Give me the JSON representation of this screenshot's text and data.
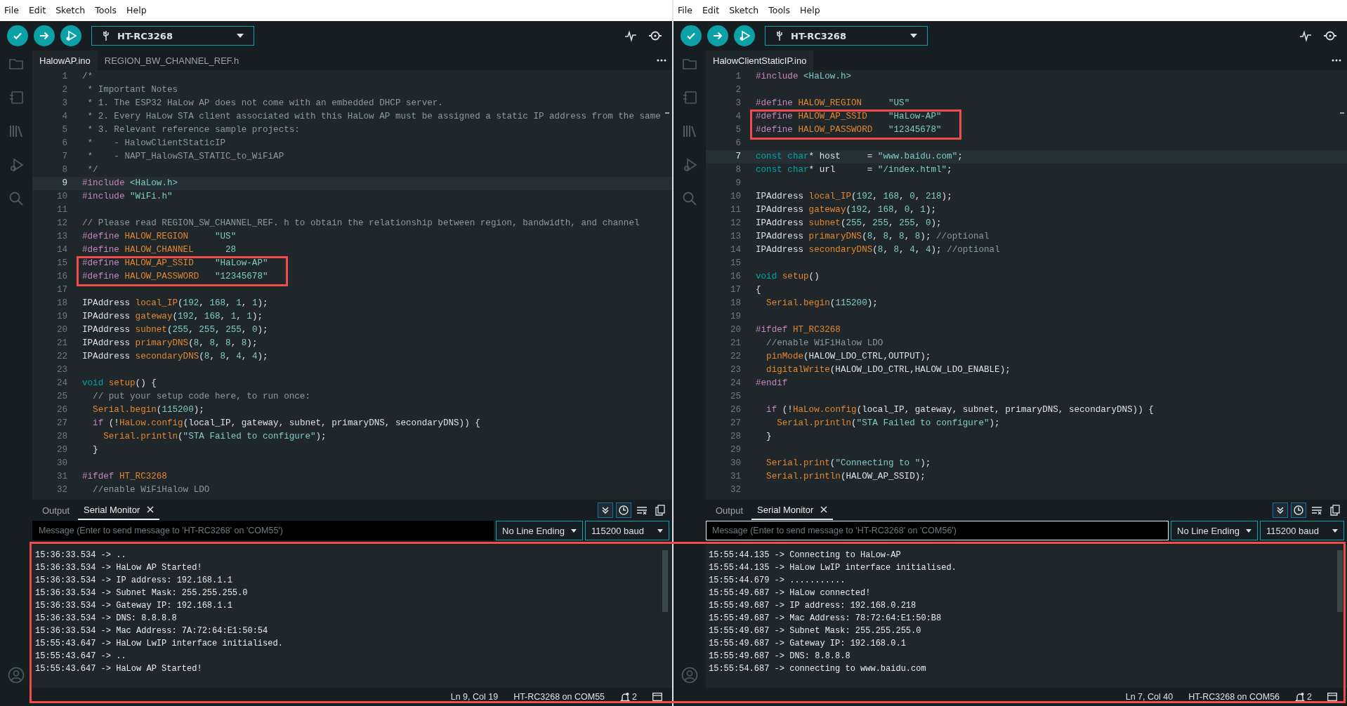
{
  "windows": [
    {
      "menu": [
        "File",
        "Edit",
        "Sketch",
        "Tools",
        "Help"
      ],
      "board": "HT-RC3268",
      "tabs": [
        {
          "label": "HalowAP.ino",
          "selected": true
        },
        {
          "label": "REGION_BW_CHANNEL_REF.h",
          "selected": false
        }
      ],
      "lines": [
        {
          "n": "1",
          "current": false,
          "boxed": false,
          "tokens": [
            {
              "kind": "comment",
              "text": "/*"
            }
          ]
        },
        {
          "n": "2",
          "current": false,
          "boxed": false,
          "tokens": [
            {
              "kind": "comment",
              "text": " * Important Notes"
            }
          ]
        },
        {
          "n": "3",
          "current": false,
          "boxed": false,
          "tokens": [
            {
              "kind": "comment",
              "text": " * 1. The ESP32 HaLow AP does not come with an embedded DHCP server."
            }
          ]
        },
        {
          "n": "4",
          "current": false,
          "boxed": false,
          "tokens": [
            {
              "kind": "comment",
              "text": " * 2. Every HaLow STA client associated with this HaLow AP must be assigned a static IP address from the same"
            }
          ]
        },
        {
          "n": "5",
          "current": false,
          "boxed": false,
          "tokens": [
            {
              "kind": "comment",
              "text": " * 3. Relevant reference sample projects:"
            }
          ]
        },
        {
          "n": "6",
          "current": false,
          "boxed": false,
          "tokens": [
            {
              "kind": "comment",
              "text": " *    - HalowClientStaticIP"
            }
          ]
        },
        {
          "n": "7",
          "current": false,
          "boxed": false,
          "tokens": [
            {
              "kind": "comment",
              "text": " *    - NAPT_HalowSTA_STATIC_to_WiFiAP"
            }
          ]
        },
        {
          "n": "8",
          "current": false,
          "boxed": false,
          "tokens": [
            {
              "kind": "comment",
              "text": " */"
            }
          ]
        },
        {
          "n": "9",
          "current": true,
          "boxed": false,
          "tokens": [
            {
              "kind": "preproc",
              "text": "#include "
            },
            {
              "kind": "string",
              "text": "<HaLow.h>"
            }
          ]
        },
        {
          "n": "10",
          "current": false,
          "boxed": false,
          "tokens": [
            {
              "kind": "preproc",
              "text": "#include "
            },
            {
              "kind": "string",
              "text": "\"WiFi.h\""
            }
          ]
        },
        {
          "n": "11",
          "current": false,
          "boxed": false
        },
        {
          "n": "12",
          "current": false,
          "boxed": false,
          "tokens": [
            {
              "kind": "comment",
              "text": "// Please read REGION_SW_CHANNEL_REF. h to obtain the relationship between region, bandwidth, and channel"
            }
          ]
        },
        {
          "n": "13",
          "current": false,
          "boxed": false,
          "tokens": [
            {
              "kind": "preproc",
              "text": "#define "
            },
            {
              "kind": "macro",
              "text": "HALOW_REGION     "
            },
            {
              "kind": "string",
              "text": "\"US\""
            }
          ]
        },
        {
          "n": "14",
          "current": false,
          "boxed": false,
          "tokens": [
            {
              "kind": "preproc",
              "text": "#define "
            },
            {
              "kind": "macro",
              "text": "HALOW_CHANNEL      "
            },
            {
              "kind": "number",
              "text": "28"
            }
          ]
        },
        {
          "n": "15",
          "current": false,
          "boxed": true,
          "tokens": [
            {
              "kind": "preproc",
              "text": "#define "
            },
            {
              "kind": "macro",
              "text": "HALOW_AP_SSID    "
            },
            {
              "kind": "string",
              "text": "\"HaLow-AP\""
            }
          ]
        },
        {
          "n": "16",
          "current": false,
          "boxed": true,
          "tokens": [
            {
              "kind": "preproc",
              "text": "#define "
            },
            {
              "kind": "macro",
              "text": "HALOW_PASSWORD   "
            },
            {
              "kind": "string",
              "text": "\"12345678\""
            }
          ]
        },
        {
          "n": "17",
          "current": false,
          "boxed": false
        },
        {
          "n": "18",
          "current": false,
          "boxed": false,
          "tokens": [
            {
              "kind": "plain",
              "text": "IPAddress "
            },
            {
              "kind": "func",
              "text": "local_IP"
            },
            {
              "kind": "plain",
              "text": "("
            },
            {
              "kind": "number",
              "text": "192"
            },
            {
              "kind": "plain",
              "text": ", "
            },
            {
              "kind": "number",
              "text": "168"
            },
            {
              "kind": "plain",
              "text": ", "
            },
            {
              "kind": "number",
              "text": "1"
            },
            {
              "kind": "plain",
              "text": ", "
            },
            {
              "kind": "number",
              "text": "1"
            },
            {
              "kind": "plain",
              "text": ");"
            }
          ]
        },
        {
          "n": "19",
          "current": false,
          "boxed": false,
          "tokens": [
            {
              "kind": "plain",
              "text": "IPAddress "
            },
            {
              "kind": "func",
              "text": "gateway"
            },
            {
              "kind": "plain",
              "text": "("
            },
            {
              "kind": "number",
              "text": "192"
            },
            {
              "kind": "plain",
              "text": ", "
            },
            {
              "kind": "number",
              "text": "168"
            },
            {
              "kind": "plain",
              "text": ", "
            },
            {
              "kind": "number",
              "text": "1"
            },
            {
              "kind": "plain",
              "text": ", "
            },
            {
              "kind": "number",
              "text": "1"
            },
            {
              "kind": "plain",
              "text": ");"
            }
          ]
        },
        {
          "n": "20",
          "current": false,
          "boxed": false,
          "tokens": [
            {
              "kind": "plain",
              "text": "IPAddress "
            },
            {
              "kind": "func",
              "text": "subnet"
            },
            {
              "kind": "plain",
              "text": "("
            },
            {
              "kind": "number",
              "text": "255"
            },
            {
              "kind": "plain",
              "text": ", "
            },
            {
              "kind": "number",
              "text": "255"
            },
            {
              "kind": "plain",
              "text": ", "
            },
            {
              "kind": "number",
              "text": "255"
            },
            {
              "kind": "plain",
              "text": ", "
            },
            {
              "kind": "number",
              "text": "0"
            },
            {
              "kind": "plain",
              "text": ");"
            }
          ]
        },
        {
          "n": "21",
          "current": false,
          "boxed": false,
          "tokens": [
            {
              "kind": "plain",
              "text": "IPAddress "
            },
            {
              "kind": "func",
              "text": "primaryDNS"
            },
            {
              "kind": "plain",
              "text": "("
            },
            {
              "kind": "number",
              "text": "8"
            },
            {
              "kind": "plain",
              "text": ", "
            },
            {
              "kind": "number",
              "text": "8"
            },
            {
              "kind": "plain",
              "text": ", "
            },
            {
              "kind": "number",
              "text": "8"
            },
            {
              "kind": "plain",
              "text": ", "
            },
            {
              "kind": "number",
              "text": "8"
            },
            {
              "kind": "plain",
              "text": ");"
            }
          ]
        },
        {
          "n": "22",
          "current": false,
          "boxed": false,
          "tokens": [
            {
              "kind": "plain",
              "text": "IPAddress "
            },
            {
              "kind": "func",
              "text": "secondaryDNS"
            },
            {
              "kind": "plain",
              "text": "("
            },
            {
              "kind": "number",
              "text": "8"
            },
            {
              "kind": "plain",
              "text": ", "
            },
            {
              "kind": "number",
              "text": "8"
            },
            {
              "kind": "plain",
              "text": ", "
            },
            {
              "kind": "number",
              "text": "4"
            },
            {
              "kind": "plain",
              "text": ", "
            },
            {
              "kind": "number",
              "text": "4"
            },
            {
              "kind": "plain",
              "text": ");"
            }
          ]
        },
        {
          "n": "23",
          "current": false,
          "boxed": false
        },
        {
          "n": "24",
          "current": false,
          "boxed": false,
          "tokens": [
            {
              "kind": "type",
              "text": "void "
            },
            {
              "kind": "func",
              "text": "setup"
            },
            {
              "kind": "plain",
              "text": "() {"
            }
          ]
        },
        {
          "n": "25",
          "current": false,
          "boxed": false,
          "tokens": [
            {
              "kind": "comment",
              "text": "  // put your setup code here, to run once:"
            }
          ]
        },
        {
          "n": "26",
          "current": false,
          "boxed": false,
          "tokens": [
            {
              "kind": "func",
              "text": "  Serial.begin"
            },
            {
              "kind": "plain",
              "text": "("
            },
            {
              "kind": "number",
              "text": "115200"
            },
            {
              "kind": "plain",
              "text": ");"
            }
          ]
        },
        {
          "n": "27",
          "current": false,
          "boxed": false,
          "tokens": [
            {
              "kind": "preproc",
              "text": "  if"
            },
            {
              "kind": "plain",
              "text": " (!"
            },
            {
              "kind": "func",
              "text": "HaLow.config"
            },
            {
              "kind": "plain",
              "text": "(local_IP, gateway, subnet, primaryDNS, secondaryDNS)) {"
            }
          ]
        },
        {
          "n": "28",
          "current": false,
          "boxed": false,
          "tokens": [
            {
              "kind": "func",
              "text": "    Serial.println"
            },
            {
              "kind": "plain",
              "text": "("
            },
            {
              "kind": "string",
              "text": "\"STA Failed to configure\""
            },
            {
              "kind": "plain",
              "text": ");"
            }
          ]
        },
        {
          "n": "29",
          "current": false,
          "boxed": false,
          "tokens": [
            {
              "kind": "plain",
              "text": "  }"
            }
          ]
        },
        {
          "n": "30",
          "current": false,
          "boxed": false
        },
        {
          "n": "31",
          "current": false,
          "boxed": false,
          "tokens": [
            {
              "kind": "preproc",
              "text": "#ifdef "
            },
            {
              "kind": "macro",
              "text": "HT_RC3268"
            }
          ]
        },
        {
          "n": "32",
          "current": false,
          "boxed": false,
          "tokens": [
            {
              "kind": "comment",
              "text": "  //enable WiFiHalow LDO"
            }
          ]
        }
      ],
      "panel_tabs": [
        {
          "label": "Output",
          "selected": false
        },
        {
          "label": "Serial Monitor",
          "selected": true
        }
      ],
      "autoscroll_on": true,
      "timestamp_on": true,
      "message": {
        "placeholder": "Message (Enter to send message to 'HT-RC3268' on 'COM55')",
        "focused": false
      },
      "line_ending": "No Line Ending",
      "baud": "115200 baud",
      "output": [
        "15:36:33.534 -> ..",
        "15:36:33.534 -> HaLow AP Started!",
        "15:36:33.534 -> IP address: 192.168.1.1",
        "15:36:33.534 -> Subnet Mask: 255.255.255.0",
        "15:36:33.534 -> Gateway IP: 192.168.1.1",
        "15:36:33.534 -> DNS: 8.8.8.8",
        "15:36:33.534 -> Mac Address: 7A:72:64:E1:50:54",
        "15:55:43.647 -> HaLow LwIP interface initialised.",
        "15:55:43.647 -> ..",
        "15:55:43.647 -> HaLow AP Started!"
      ],
      "status": {
        "position": "Ln 9, Col 19",
        "port": "HT-RC3268 on COM55",
        "notifications": "2"
      }
    },
    {
      "menu": [
        "File",
        "Edit",
        "Sketch",
        "Tools",
        "Help"
      ],
      "board": "HT-RC3268",
      "tabs": [
        {
          "label": "HalowClientStaticIP.ino",
          "selected": true
        }
      ],
      "lines": [
        {
          "n": "1",
          "current": false,
          "boxed": false,
          "tokens": [
            {
              "kind": "preproc",
              "text": "#include "
            },
            {
              "kind": "string",
              "text": "<HaLow.h>"
            }
          ]
        },
        {
          "n": "2",
          "current": false,
          "boxed": false
        },
        {
          "n": "3",
          "current": false,
          "boxed": false,
          "tokens": [
            {
              "kind": "preproc",
              "text": "#define "
            },
            {
              "kind": "macro",
              "text": "HALOW_REGION     "
            },
            {
              "kind": "string",
              "text": "\"US\""
            }
          ]
        },
        {
          "n": "4",
          "current": false,
          "boxed": true,
          "tokens": [
            {
              "kind": "preproc",
              "text": "#define "
            },
            {
              "kind": "macro",
              "text": "HALOW_AP_SSID    "
            },
            {
              "kind": "string",
              "text": "\"HaLow-AP\""
            }
          ]
        },
        {
          "n": "5",
          "current": false,
          "boxed": true,
          "tokens": [
            {
              "kind": "preproc",
              "text": "#define "
            },
            {
              "kind": "macro",
              "text": "HALOW_PASSWORD   "
            },
            {
              "kind": "string",
              "text": "\"12345678\""
            }
          ]
        },
        {
          "n": "6",
          "current": false,
          "boxed": false
        },
        {
          "n": "7",
          "current": true,
          "boxed": false,
          "tokens": [
            {
              "kind": "type",
              "text": "const char"
            },
            {
              "kind": "plain",
              "text": "* host     = "
            },
            {
              "kind": "string",
              "text": "\"www.baidu.com\""
            },
            {
              "kind": "plain",
              "text": ";"
            }
          ]
        },
        {
          "n": "8",
          "current": false,
          "boxed": false,
          "tokens": [
            {
              "kind": "type",
              "text": "const char"
            },
            {
              "kind": "plain",
              "text": "* url      = "
            },
            {
              "kind": "string",
              "text": "\"/index.html\""
            },
            {
              "kind": "plain",
              "text": ";"
            }
          ]
        },
        {
          "n": "9",
          "current": false,
          "boxed": false
        },
        {
          "n": "10",
          "current": false,
          "boxed": false,
          "tokens": [
            {
              "kind": "plain",
              "text": "IPAddress "
            },
            {
              "kind": "func",
              "text": "local_IP"
            },
            {
              "kind": "plain",
              "text": "("
            },
            {
              "kind": "number",
              "text": "192"
            },
            {
              "kind": "plain",
              "text": ", "
            },
            {
              "kind": "number",
              "text": "168"
            },
            {
              "kind": "plain",
              "text": ", "
            },
            {
              "kind": "number",
              "text": "0"
            },
            {
              "kind": "plain",
              "text": ", "
            },
            {
              "kind": "number",
              "text": "218"
            },
            {
              "kind": "plain",
              "text": ");"
            }
          ]
        },
        {
          "n": "11",
          "current": false,
          "boxed": false,
          "tokens": [
            {
              "kind": "plain",
              "text": "IPAddress "
            },
            {
              "kind": "func",
              "text": "gateway"
            },
            {
              "kind": "plain",
              "text": "("
            },
            {
              "kind": "number",
              "text": "192"
            },
            {
              "kind": "plain",
              "text": ", "
            },
            {
              "kind": "number",
              "text": "168"
            },
            {
              "kind": "plain",
              "text": ", "
            },
            {
              "kind": "number",
              "text": "0"
            },
            {
              "kind": "plain",
              "text": ", "
            },
            {
              "kind": "number",
              "text": "1"
            },
            {
              "kind": "plain",
              "text": ");"
            }
          ]
        },
        {
          "n": "12",
          "current": false,
          "boxed": false,
          "tokens": [
            {
              "kind": "plain",
              "text": "IPAddress "
            },
            {
              "kind": "func",
              "text": "subnet"
            },
            {
              "kind": "plain",
              "text": "("
            },
            {
              "kind": "number",
              "text": "255"
            },
            {
              "kind": "plain",
              "text": ", "
            },
            {
              "kind": "number",
              "text": "255"
            },
            {
              "kind": "plain",
              "text": ", "
            },
            {
              "kind": "number",
              "text": "255"
            },
            {
              "kind": "plain",
              "text": ", "
            },
            {
              "kind": "number",
              "text": "0"
            },
            {
              "kind": "plain",
              "text": ");"
            }
          ]
        },
        {
          "n": "13",
          "current": false,
          "boxed": false,
          "tokens": [
            {
              "kind": "plain",
              "text": "IPAddress "
            },
            {
              "kind": "func",
              "text": "primaryDNS"
            },
            {
              "kind": "plain",
              "text": "("
            },
            {
              "kind": "number",
              "text": "8"
            },
            {
              "kind": "plain",
              "text": ", "
            },
            {
              "kind": "number",
              "text": "8"
            },
            {
              "kind": "plain",
              "text": ", "
            },
            {
              "kind": "number",
              "text": "8"
            },
            {
              "kind": "plain",
              "text": ", "
            },
            {
              "kind": "number",
              "text": "8"
            },
            {
              "kind": "plain",
              "text": "); "
            },
            {
              "kind": "comment",
              "text": "//optional"
            }
          ]
        },
        {
          "n": "14",
          "current": false,
          "boxed": false,
          "tokens": [
            {
              "kind": "plain",
              "text": "IPAddress "
            },
            {
              "kind": "func",
              "text": "secondaryDNS"
            },
            {
              "kind": "plain",
              "text": "("
            },
            {
              "kind": "number",
              "text": "8"
            },
            {
              "kind": "plain",
              "text": ", "
            },
            {
              "kind": "number",
              "text": "8"
            },
            {
              "kind": "plain",
              "text": ", "
            },
            {
              "kind": "number",
              "text": "4"
            },
            {
              "kind": "plain",
              "text": ", "
            },
            {
              "kind": "number",
              "text": "4"
            },
            {
              "kind": "plain",
              "text": "); "
            },
            {
              "kind": "comment",
              "text": "//optional"
            }
          ]
        },
        {
          "n": "15",
          "current": false,
          "boxed": false
        },
        {
          "n": "16",
          "current": false,
          "boxed": false,
          "tokens": [
            {
              "kind": "type",
              "text": "void "
            },
            {
              "kind": "func",
              "text": "setup"
            },
            {
              "kind": "plain",
              "text": "()"
            }
          ]
        },
        {
          "n": "17",
          "current": false,
          "boxed": false,
          "tokens": [
            {
              "kind": "plain",
              "text": "{"
            }
          ]
        },
        {
          "n": "18",
          "current": false,
          "boxed": false,
          "tokens": [
            {
              "kind": "func",
              "text": "  Serial.begin"
            },
            {
              "kind": "plain",
              "text": "("
            },
            {
              "kind": "number",
              "text": "115200"
            },
            {
              "kind": "plain",
              "text": ");"
            }
          ]
        },
        {
          "n": "19",
          "current": false,
          "boxed": false
        },
        {
          "n": "20",
          "current": false,
          "boxed": false,
          "tokens": [
            {
              "kind": "preproc",
              "text": "#ifdef "
            },
            {
              "kind": "macro",
              "text": "HT_RC3268"
            }
          ]
        },
        {
          "n": "21",
          "current": false,
          "boxed": false,
          "tokens": [
            {
              "kind": "comment",
              "text": "  //enable WiFiHalow LDO"
            }
          ]
        },
        {
          "n": "22",
          "current": false,
          "boxed": false,
          "tokens": [
            {
              "kind": "func",
              "text": "  pinMode"
            },
            {
              "kind": "plain",
              "text": "(HALOW_LDO_CTRL,OUTPUT);"
            }
          ]
        },
        {
          "n": "23",
          "current": false,
          "boxed": false,
          "tokens": [
            {
              "kind": "func",
              "text": "  digitalWrite"
            },
            {
              "kind": "plain",
              "text": "(HALOW_LDO_CTRL,HALOW_LDO_ENABLE);"
            }
          ]
        },
        {
          "n": "24",
          "current": false,
          "boxed": false,
          "tokens": [
            {
              "kind": "preproc",
              "text": "#endif"
            }
          ]
        },
        {
          "n": "25",
          "current": false,
          "boxed": false
        },
        {
          "n": "26",
          "current": false,
          "boxed": false,
          "tokens": [
            {
              "kind": "preproc",
              "text": "  if"
            },
            {
              "kind": "plain",
              "text": " (!"
            },
            {
              "kind": "func",
              "text": "HaLow.config"
            },
            {
              "kind": "plain",
              "text": "(local_IP, gateway, subnet, primaryDNS, secondaryDNS)) {"
            }
          ]
        },
        {
          "n": "27",
          "current": false,
          "boxed": false,
          "tokens": [
            {
              "kind": "func",
              "text": "    Serial.println"
            },
            {
              "kind": "plain",
              "text": "("
            },
            {
              "kind": "string",
              "text": "\"STA Failed to configure\""
            },
            {
              "kind": "plain",
              "text": ");"
            }
          ]
        },
        {
          "n": "28",
          "current": false,
          "boxed": false,
          "tokens": [
            {
              "kind": "plain",
              "text": "  }"
            }
          ]
        },
        {
          "n": "29",
          "current": false,
          "boxed": false
        },
        {
          "n": "30",
          "current": false,
          "boxed": false,
          "tokens": [
            {
              "kind": "func",
              "text": "  Serial.print"
            },
            {
              "kind": "plain",
              "text": "("
            },
            {
              "kind": "string",
              "text": "\"Connecting to \""
            },
            {
              "kind": "plain",
              "text": ");"
            }
          ]
        },
        {
          "n": "31",
          "current": false,
          "boxed": false,
          "tokens": [
            {
              "kind": "func",
              "text": "  Serial.println"
            },
            {
              "kind": "plain",
              "text": "(HALOW_AP_SSID);"
            }
          ]
        },
        {
          "n": "32",
          "current": false,
          "boxed": false
        }
      ],
      "panel_tabs": [
        {
          "label": "Output",
          "selected": false
        },
        {
          "label": "Serial Monitor",
          "selected": true
        }
      ],
      "autoscroll_on": true,
      "timestamp_on": true,
      "message": {
        "placeholder": "Message (Enter to send message to 'HT-RC3268' on 'COM56')",
        "focused": true
      },
      "line_ending": "No Line Ending",
      "baud": "115200 baud",
      "output": [
        "15:55:44.135 -> Connecting to HaLow-AP",
        "15:55:44.135 -> HaLow LwIP interface initialised.",
        "15:55:44.679 -> ...........",
        "15:55:49.687 -> HaLow connected!",
        "15:55:49.687 -> IP address: 192.168.0.218",
        "15:55:49.687 -> Mac Address: 78:72:64:E1:50:B8",
        "15:55:49.687 -> Subnet Mask: 255.255.255.0",
        "15:55:49.687 -> Gateway IP: 192.168.0.1",
        "15:55:49.687 -> DNS: 8.8.8.8",
        "15:55:54.687 -> connecting to www.baidu.com"
      ],
      "status": {
        "position": "Ln 7, Col 40",
        "port": "HT-RC3268 on COM56",
        "notifications": "2"
      }
    }
  ],
  "annotations": [
    {
      "kind": "output-frame"
    }
  ]
}
